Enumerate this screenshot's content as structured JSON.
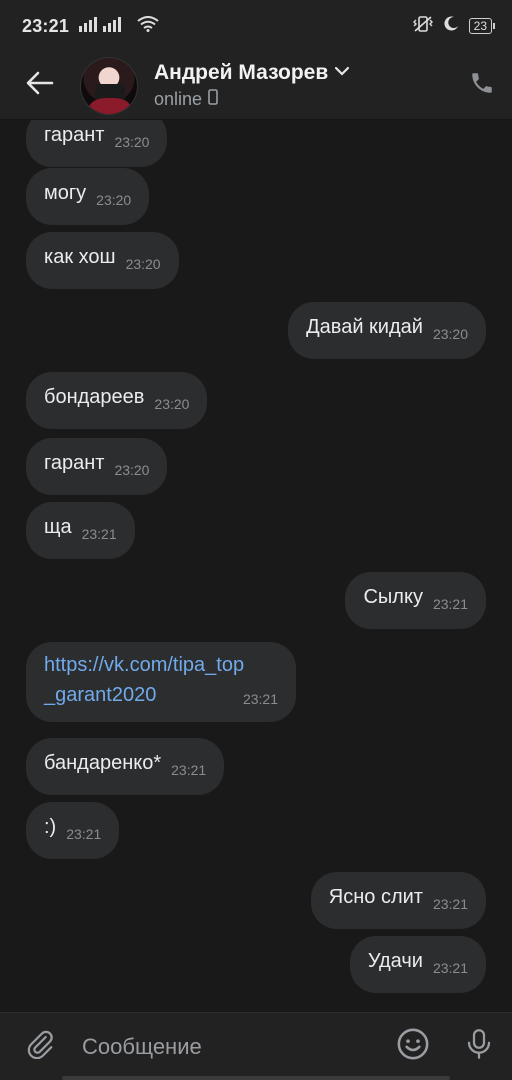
{
  "statusbar": {
    "time": "23:21",
    "battery": "23"
  },
  "header": {
    "name": "Андрей Мазорев",
    "status": "online"
  },
  "messages": [
    {
      "text": "гарант",
      "time": "23:20",
      "side": "in"
    },
    {
      "text": "могу",
      "time": "23:20",
      "side": "in"
    },
    {
      "text": "как хош",
      "time": "23:20",
      "side": "in"
    },
    {
      "text": "Давай кидай",
      "time": "23:20",
      "side": "out"
    },
    {
      "text": "бондареев",
      "time": "23:20",
      "side": "in"
    },
    {
      "text": "гарант",
      "time": "23:20",
      "side": "in"
    },
    {
      "text": "ща",
      "time": "23:21",
      "side": "in"
    },
    {
      "text": "Сылку",
      "time": "23:21",
      "side": "out"
    },
    {
      "text_line1": "https://vk.com/tipa_top",
      "text_line2": "_garant2020",
      "time": "23:21",
      "side": "in"
    },
    {
      "text": "бандаренко*",
      "time": "23:21",
      "side": "in"
    },
    {
      "text": ":)",
      "time": "23:21",
      "side": "in"
    },
    {
      "text": "Ясно слит",
      "time": "23:21",
      "side": "out"
    },
    {
      "text": "Удачи",
      "time": "23:21",
      "side": "out"
    }
  ],
  "composer": {
    "placeholder": "Сообщение"
  },
  "colors": {
    "background": "#19191a",
    "bubble": "#2c2d2e",
    "link": "#71aaeb",
    "bar": "#222222"
  }
}
